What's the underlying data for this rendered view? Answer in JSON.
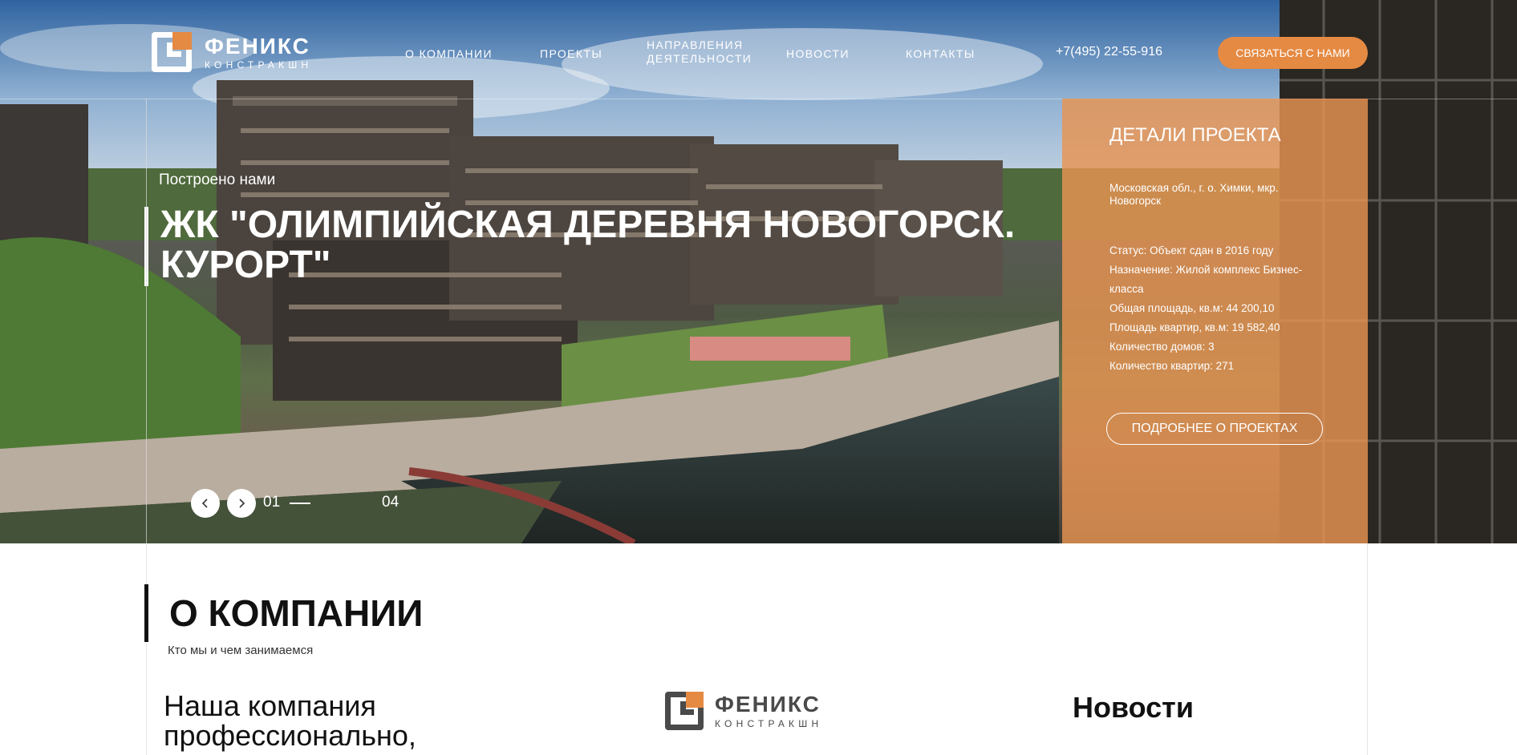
{
  "header": {
    "logo": {
      "name": "ФЕНИКС",
      "sub": "КОНСТРАКШН"
    },
    "nav": [
      {
        "label": "О КОМПАНИИ"
      },
      {
        "label": "ПРОЕКТЫ"
      },
      {
        "label": "НАПРАВЛЕНИЯ",
        "label2": "ДЕЯТЕЛЬНОСТИ"
      },
      {
        "label": "НОВОСТИ"
      },
      {
        "label": "КОНТАКТЫ"
      }
    ],
    "phone": "+7(495) 22-55-916",
    "cta_label": "СВЯЗАТЬСЯ С НАМИ"
  },
  "hero": {
    "built_by": "Построено нами",
    "title": "ЖК \"ОЛИМПИЙСКАЯ ДЕРЕВНЯ НОВОГОРСК. КУРОРТ\"",
    "slider": {
      "current": "01",
      "total": "04"
    }
  },
  "details": {
    "title": "ДЕТАЛИ ПРОЕКТА",
    "address": "Московская обл., г. о. Химки, мкр. Новогорск",
    "items": [
      "Статус: Объект сдан в 2016 году",
      "Назначение: Жилой комплекс Бизнес-класса",
      "Общая площадь, кв.м: 44 200,10",
      "Площадь квартир, кв.м: 19 582,40",
      "Количество домов: 3",
      "Количество квартир: 271"
    ],
    "button_label": "ПОДРОБНЕЕ О ПРОЕКТАХ"
  },
  "about": {
    "title": "О КОМПАНИИ",
    "subtitle": "Кто мы и чем занимаемся",
    "text": "Наша компания профессионально,",
    "logo": {
      "name": "ФЕНИКС",
      "sub": "КОНСТРАКШН"
    },
    "news_title": "Новости"
  },
  "colors": {
    "accent": "#e58a43",
    "panel": "#e89452",
    "text_dark": "#111111"
  },
  "icons": {
    "prev": "chevron-left-icon",
    "next": "chevron-right-icon",
    "logo": "phoenix-logo-icon"
  }
}
